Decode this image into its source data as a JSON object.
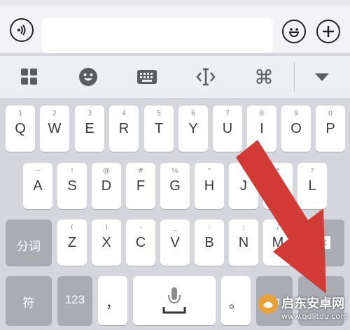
{
  "input_bar": {
    "voice_icon": "voice-input-icon",
    "text_value": "",
    "emoji_icon": "smiley-icon",
    "plus_icon": "plus-icon"
  },
  "toolbar": {
    "items": [
      "grid-apps-icon",
      "emoji-face-icon",
      "keyboard-icon",
      "cursor-move-icon",
      "command-icon",
      "collapse-arrow-icon"
    ]
  },
  "keyboard": {
    "row1": [
      {
        "hint": "1",
        "key": "Q"
      },
      {
        "hint": "2",
        "key": "W"
      },
      {
        "hint": "3",
        "key": "E"
      },
      {
        "hint": "4",
        "key": "R"
      },
      {
        "hint": "5",
        "key": "T"
      },
      {
        "hint": "6",
        "key": "Y"
      },
      {
        "hint": "7",
        "key": "U"
      },
      {
        "hint": "8",
        "key": "I"
      },
      {
        "hint": "9",
        "key": "O"
      },
      {
        "hint": "0",
        "key": "P"
      }
    ],
    "row2": [
      {
        "hint": "~",
        "key": "A"
      },
      {
        "hint": "!",
        "key": "S"
      },
      {
        "hint": "@",
        "key": "D"
      },
      {
        "hint": "#",
        "key": "F"
      },
      {
        "hint": "%",
        "key": "G"
      },
      {
        "hint": "\"",
        "key": "H"
      },
      {
        "hint": "\"",
        "key": "J"
      },
      {
        "hint": "*",
        "key": "K"
      },
      {
        "hint": "?",
        "key": "L"
      }
    ],
    "row3": [
      {
        "hint": "(",
        "key": "Z"
      },
      {
        "hint": ")",
        "key": "X"
      },
      {
        "hint": "-",
        "key": "C"
      },
      {
        "hint": "_",
        "key": "V"
      },
      {
        "hint": ":",
        "key": "B"
      },
      {
        "hint": ";",
        "key": "N"
      },
      {
        "hint": "/",
        "key": "M"
      }
    ],
    "segment_label": "分词",
    "symbol_label": "符",
    "numbers_label": "123",
    "comma": "，",
    "period": "。",
    "lang_label": "中"
  },
  "watermark": {
    "text": "启东安卓网",
    "url": "www.qdlitdu.com"
  },
  "colors": {
    "arrow": "#d23b35",
    "dark_key": "#a9adb3",
    "keyboard_bg": "#d4d6db"
  }
}
